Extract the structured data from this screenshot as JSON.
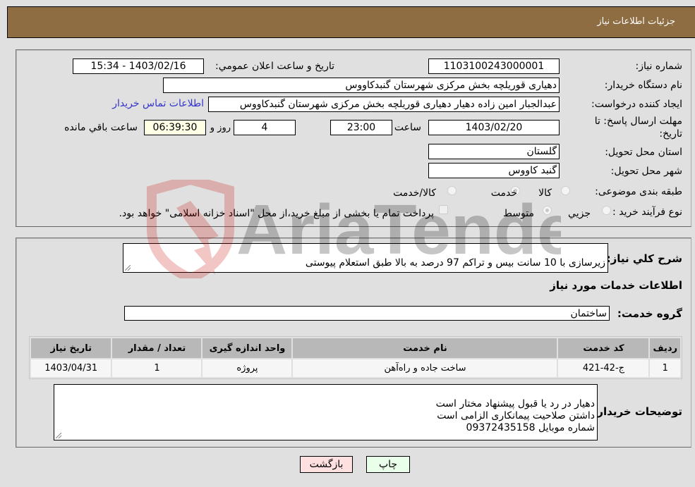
{
  "header": {
    "title": "جزئیات اطلاعات نیاز"
  },
  "details": {
    "need_number": {
      "label": "شماره نیاز:",
      "value": "1103100243000001"
    },
    "announce_datetime": {
      "label": "تاریخ و ساعت اعلان عمومي:",
      "value": "1403/02/16 - 15:34"
    },
    "buyer_org": {
      "label": "نام دستگاه خریدار:",
      "value": "دهیاری قوریلچه بخش مرکزی شهرستان گنبدکاووس"
    },
    "requester": {
      "label": "ایجاد کننده درخواست:",
      "value": "عبدالجبار امین زاده دهیار دهیاری قوریلچه بخش مرکزی شهرستان گنبدکاووس"
    },
    "buyer_contact_link": "اطلاعات تماس خریدار",
    "deadline": {
      "label": "مهلت ارسال پاسخ: تا تاریخ:",
      "date": "1403/02/20",
      "time_label": "ساعت",
      "time": "23:00",
      "days": "4",
      "days_label": "روز و",
      "remaining": "06:39:30",
      "remaining_label": "ساعت باقي مانده"
    },
    "province": {
      "label": "استان محل تحویل:",
      "value": "گلستان"
    },
    "city": {
      "label": "شهر محل تحویل:",
      "value": "گنبد کاووس"
    },
    "category": {
      "label": "طبقه بندی موضوعی:",
      "options": [
        "کالا",
        "خدمت",
        "کالا/خدمت"
      ],
      "selected": "خدمت"
    },
    "purchase_type": {
      "label": "نوع فرآیند خرید :",
      "options": [
        "جزيي",
        "متوسط"
      ],
      "selected": "متوسط",
      "treasury_note": "پرداخت تمام یا بخشی از مبلغ خرید،از محل \"اسناد خزانه اسلامی\" خواهد بود.",
      "treasury_checked": false
    }
  },
  "description": {
    "label": "شرح کلي نياز:",
    "value": "زیرسازی با 10 سانت بیس و تراکم 97 درصد به بالا طبق استعلام پیوستی"
  },
  "services_section": {
    "title": "اطلاعات خدمات مورد نياز",
    "group_label": "گروه خدمت:",
    "group_value": "ساختمان",
    "table": {
      "columns": [
        "ردیف",
        "کد خدمت",
        "نام خدمت",
        "واحد اندازه گیری",
        "تعداد / مقدار",
        "تاریخ نیاز"
      ],
      "rows": [
        [
          "1",
          "ج-42-421",
          "ساخت جاده و راه‌آهن",
          "پروژه",
          "1",
          "1403/04/31"
        ]
      ]
    }
  },
  "buyer_notes": {
    "label": "توضیحات خریدار:",
    "value": "دهیار در رد یا قبول پیشنهاد مختار است\nداشتن صلاحیت پیمانکاری الزامی است\nشماره موبایل 09372435158"
  },
  "buttons": {
    "print": "چاپ",
    "back": "بازگشت"
  },
  "watermark": {
    "text": "AriaTender.neT"
  }
}
